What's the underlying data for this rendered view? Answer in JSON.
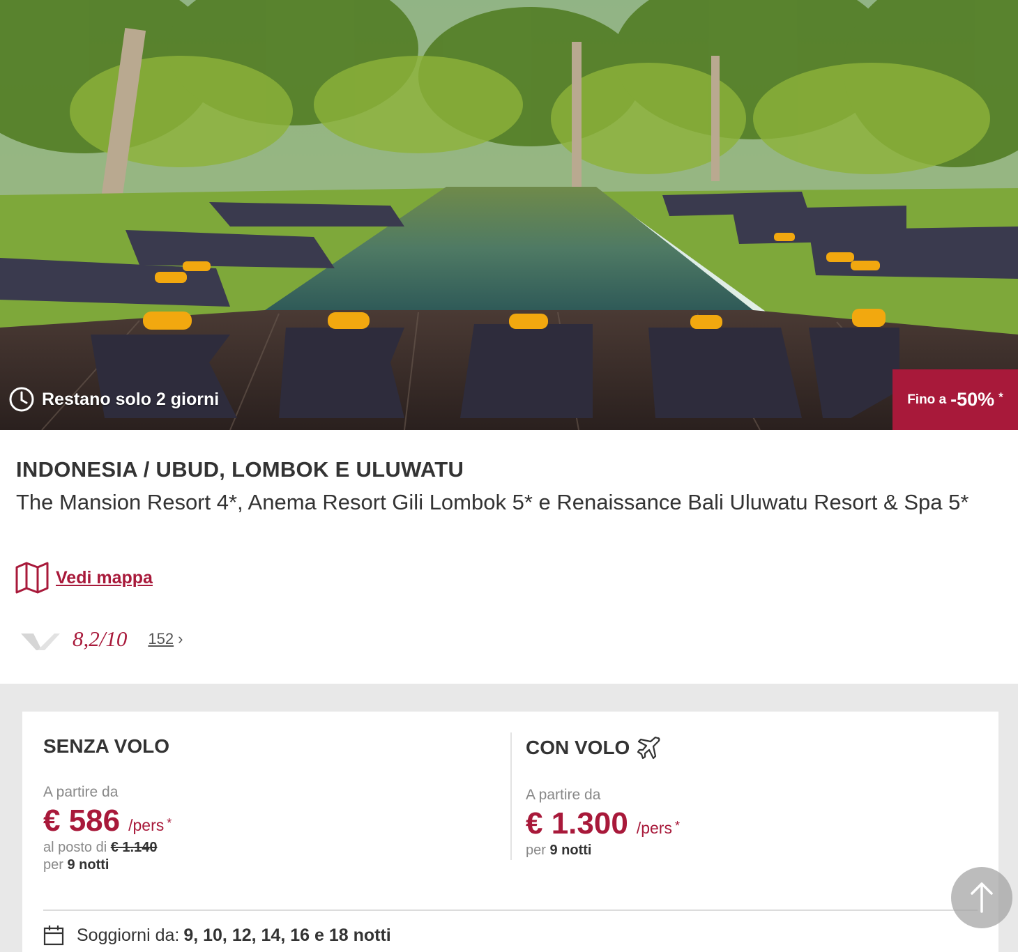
{
  "hero": {
    "countdown": "Restano solo 2 giorni",
    "discount_prefix": "Fino a",
    "discount_value": "-50%",
    "discount_star": "*"
  },
  "offer": {
    "destination": "INDONESIA / UBUD, LOMBOK E ULUWATU",
    "hotels": "The Mansion Resort 4*, Anema Resort Gili Lombok 5* e Renaissance Bali Uluwatu Resort & Spa 5*",
    "map_link": "Vedi mappa",
    "rating_score": "8,2/10",
    "review_count": "152"
  },
  "pricing": {
    "without_flight": {
      "title": "SENZA VOLO",
      "from_label": "A partire da",
      "price": "€ 586",
      "per": "/pers",
      "star": "*",
      "instead_label": "al posto di",
      "old_price": "€ 1.140",
      "nights_label": "per",
      "nights": "9 notti"
    },
    "with_flight": {
      "title": "CON VOLO",
      "from_label": "A partire da",
      "price": "€ 1.300",
      "per": "/pers",
      "star": "*",
      "nights_label": "per",
      "nights": "9 notti"
    },
    "stays_label": "Soggiorni da:",
    "stays_values": "9, 10, 12, 14, 16 e 18 notti"
  },
  "icons": [
    "clock-icon",
    "map-icon",
    "review-logo-icon",
    "chevron-right-icon",
    "airplane-icon",
    "calendar-icon",
    "arrow-up-icon"
  ],
  "colors": {
    "brand": "#a8193a",
    "gray_bg": "#e8e8e8"
  }
}
